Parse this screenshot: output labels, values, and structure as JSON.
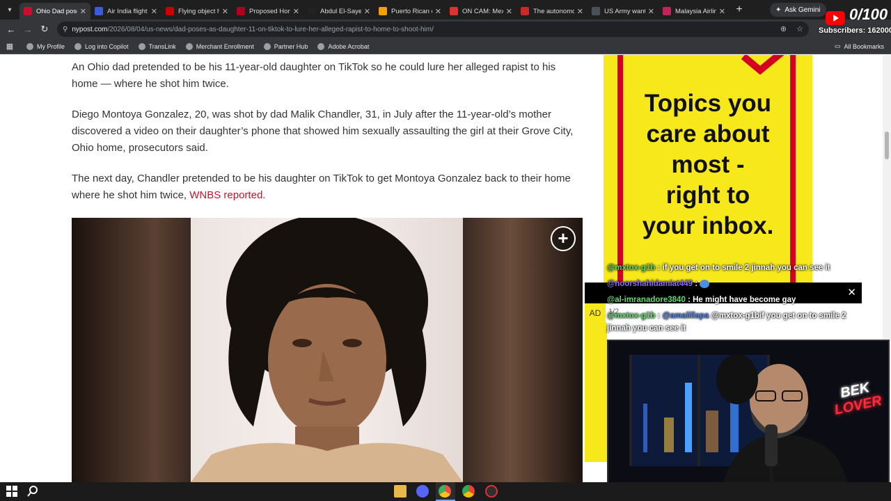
{
  "tabs": [
    {
      "title": "Ohio Dad pose",
      "color": "#c8102e",
      "active": true
    },
    {
      "title": "Air India flight",
      "color": "#3b5bdb"
    },
    {
      "title": "Flying object h",
      "color": "#cc0000"
    },
    {
      "title": "Proposed Hom",
      "color": "#b00020"
    },
    {
      "title": "Abdul El-Sayed",
      "color": "#222222"
    },
    {
      "title": "Puerto Rican c",
      "color": "#f59f00"
    },
    {
      "title": "ON CAM: Mex",
      "color": "#e03131"
    },
    {
      "title": "The autonomo",
      "color": "#c92a2a"
    },
    {
      "title": "US Army wants",
      "color": "#495057"
    },
    {
      "title": "Malaysia Airlin",
      "color": "#c2255c"
    }
  ],
  "gemini_label": "Ask Gemini",
  "url": {
    "domain": "nypost.com",
    "path": "/2026/08/04/us-news/dad-poses-as-daughter-11-on-tiktok-to-lure-her-alleged-rapist-to-home-to-shoot-him/"
  },
  "bookmarks": [
    "My Profile",
    "Log into Copilot",
    "TransLink",
    "Merchant Enrollment",
    "Partner Hub",
    "Adobe Acrobat"
  ],
  "all_bookmarks": "All Bookmarks",
  "article": {
    "p1": "An Ohio dad pretended to be his 11-year-old daughter on TikTok so he could lure her alleged rapist to his home — where he shot him twice.",
    "p2": "Diego Montoya Gonzalez, 20, was shot by dad Malik Chandler, 31, in July after the 11-year-old’s mother discovered a video on their daughter’s phone that showed him sexually assaulting the girl at their Grove City, Ohio home, prosecutors said.",
    "p3": "The next day, Chandler pretended to be his daughter on TikTok to get Montoya Gonzalez back to their home where he shot him twice,",
    "p3_link": "WNBS reported."
  },
  "ad": {
    "lines": [
      "Topics you",
      "care about",
      "most -",
      "right to",
      "your inbox."
    ],
    "label": "AD",
    "counter": "1/2"
  },
  "stream": {
    "counter": "0/100",
    "subscribers": "Subscribers: 162000",
    "chat": [
      {
        "user": "@mxtox-g1b",
        "sep": " : ",
        "msg": "if you get on to smile 2 jinnah you can see it",
        "style": "green"
      },
      {
        "user": "@noorshahidamiat449",
        "sep": " : ",
        "msg": "",
        "style": "purple"
      },
      {
        "user": "@al-imranadore3840",
        "sep": " : ",
        "msg": "He might have become gay",
        "style": "green"
      },
      {
        "user": "@mxtox-g1b",
        "sep": " : ",
        "mention": "@amalillapa",
        "msg": "@mxtox-g1bif you get on to smile 2 jinnah you can see it",
        "style": "green"
      }
    ],
    "neon_sign": [
      "BEK",
      "LOVER"
    ]
  }
}
